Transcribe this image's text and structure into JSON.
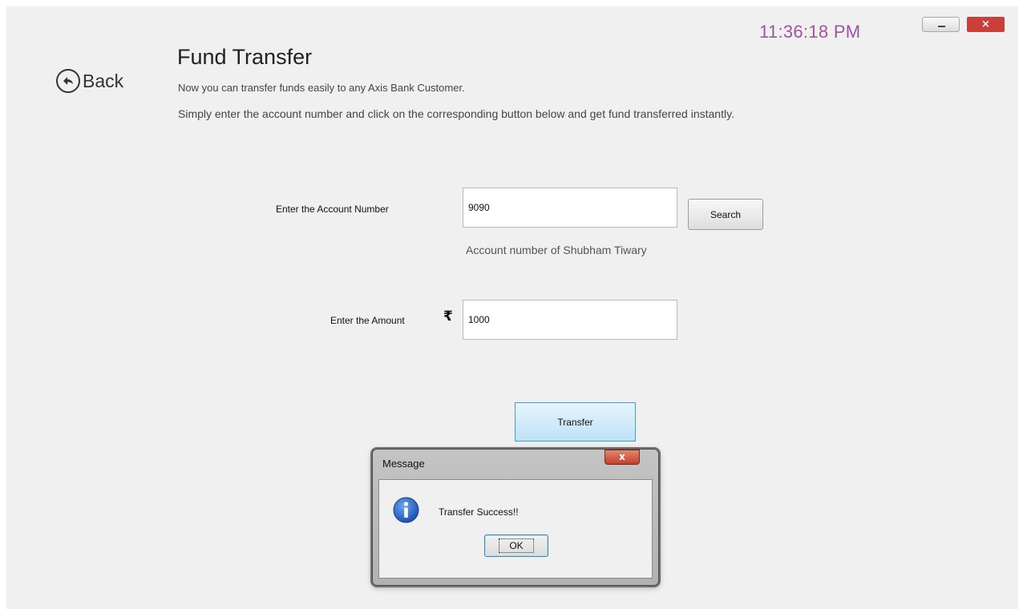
{
  "clock": "11:36:18 PM",
  "window_controls": {
    "close_glyph": "×"
  },
  "back": {
    "label": "Back",
    "icon": "back-arrow-icon"
  },
  "page": {
    "title": "Fund Transfer",
    "description_1": "Now you can transfer funds easily to any Axis Bank Customer.",
    "description_2": "Simply enter the account number and click on the corresponding button below and get fund transferred instantly."
  },
  "form": {
    "account_label": "Enter the Account Number",
    "account_value": "9090",
    "search_label": "Search",
    "account_holder_text": "Account number of Shubham  Tiwary",
    "amount_label": "Enter the Amount",
    "currency_symbol": "₹",
    "amount_value": "1000",
    "transfer_label": "Transfer"
  },
  "dialog": {
    "title": "Message",
    "close_glyph": "x",
    "message": "Transfer Success!!",
    "ok_label": "OK",
    "icon": "info-icon"
  }
}
